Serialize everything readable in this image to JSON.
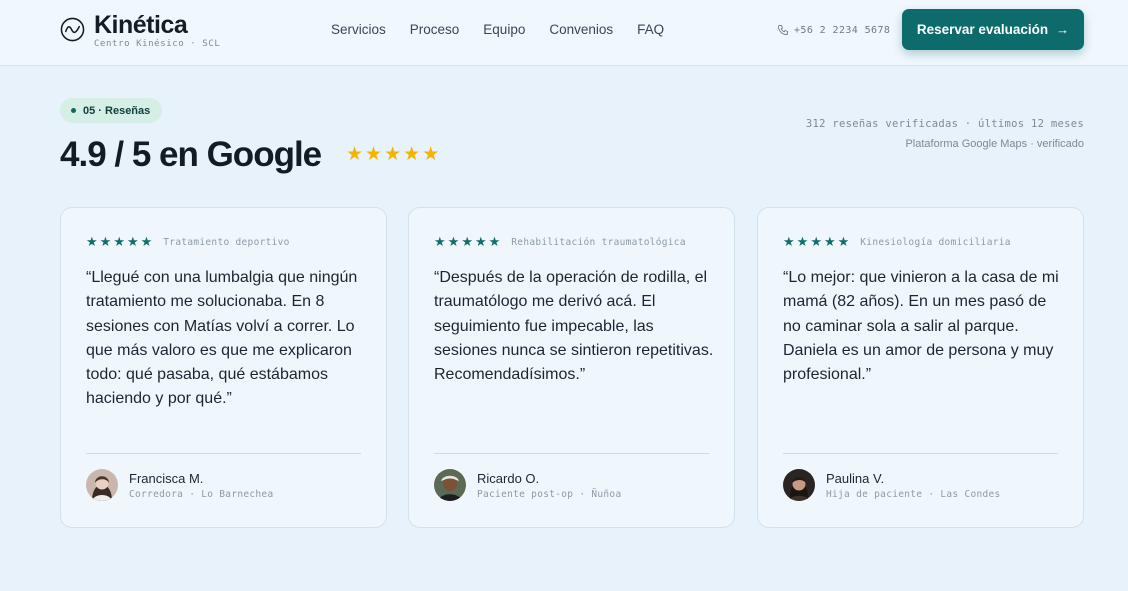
{
  "header": {
    "brand_name": "Kinética",
    "brand_sub": "Centro Kinésico · SCL",
    "nav": [
      "Servicios",
      "Proceso",
      "Equipo",
      "Convenios",
      "FAQ"
    ],
    "phone": "+56 2 2234 5678",
    "cta_label": "Reservar evaluación",
    "cta_arrow": "→"
  },
  "section": {
    "pill": "05 · Reseñas",
    "headline": "4.9 / 5 en Google",
    "rating": 5,
    "meta_line1": "312 reseñas verificadas · últimos 12 meses",
    "meta_line2": "Plataforma Google Maps · verificado"
  },
  "colors": {
    "accent": "#0e6b6b",
    "star_gold": "#f4b400",
    "star_teal": "#0d6f69",
    "background": "#e8f2fa"
  },
  "reviews": [
    {
      "stars": 5,
      "tag": "Tratamiento deportivo",
      "quote": "“Llegué con una lumbalgia que ningún tratamiento me solucionaba. En 8 sesiones con Matías volví a correr. Lo que más valoro es que me explicaron todo: qué pasaba, qué estábamos haciendo y por qué.”",
      "name": "Francisca M.",
      "role": "Corredora · Lo Barnechea",
      "avatar_icon": "avatar-photo-woman"
    },
    {
      "stars": 5,
      "tag": "Rehabilitación traumatológica",
      "quote": "“Después de la operación de rodilla, el traumatólogo me derivó acá. El seguimiento fue impecable, las sesiones nunca se sintieron repetitivas. Recomendadísimos.”",
      "name": "Ricardo O.",
      "role": "Paciente post-op · Ñuñoa",
      "avatar_icon": "avatar-photo-man"
    },
    {
      "stars": 5,
      "tag": "Kinesiología domiciliaria",
      "quote": "“Lo mejor: que vinieron a la casa de mi mamá (82 años). En un mes pasó de no caminar sola a salir al parque. Daniela es un amor de persona y muy profesional.”",
      "name": "Paulina V.",
      "role": "Hija de paciente · Las Condes",
      "avatar_icon": "avatar-photo-woman"
    }
  ]
}
